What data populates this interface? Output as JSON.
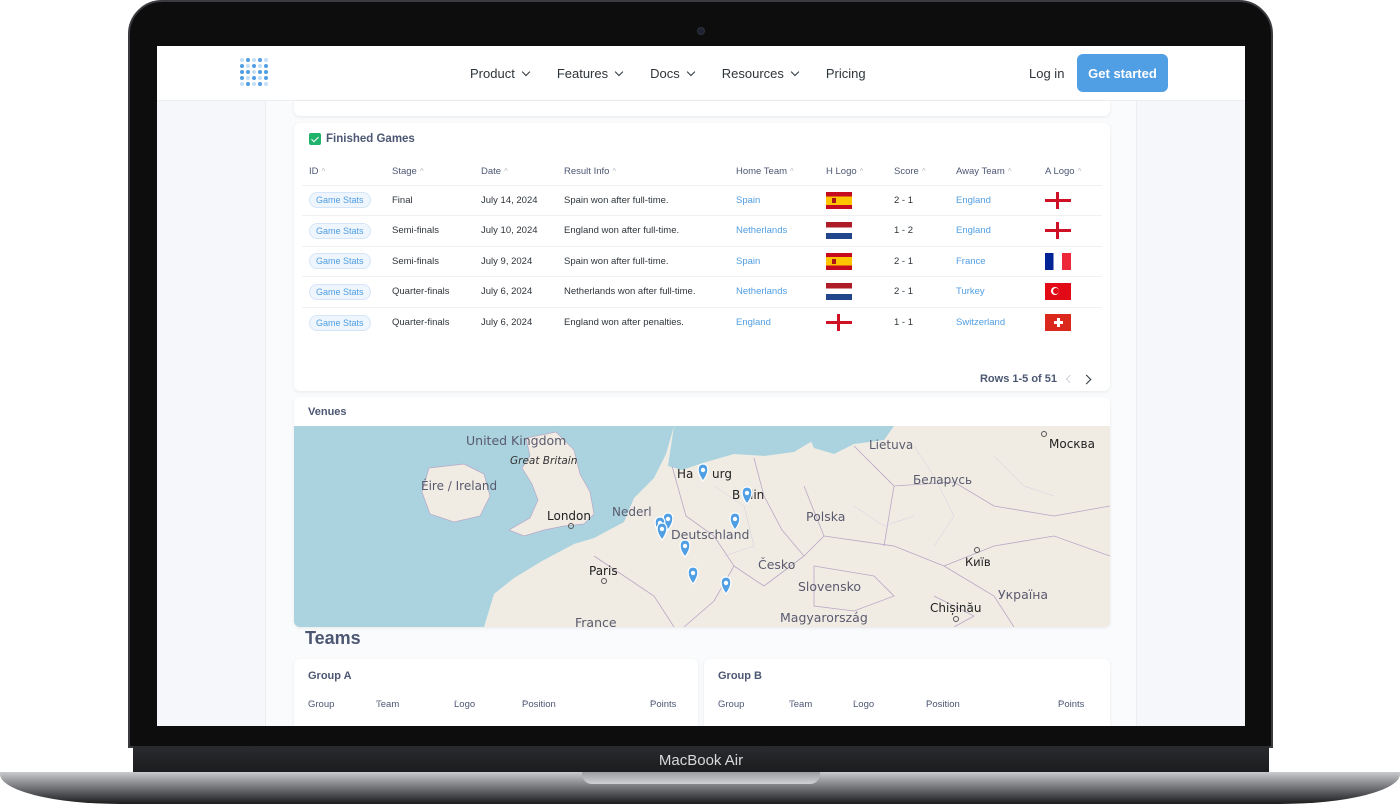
{
  "device_label": "MacBook Air",
  "nav": {
    "menu": [
      {
        "label": "Product",
        "has_dropdown": true
      },
      {
        "label": "Features",
        "has_dropdown": true
      },
      {
        "label": "Docs",
        "has_dropdown": true
      },
      {
        "label": "Resources",
        "has_dropdown": true
      },
      {
        "label": "Pricing",
        "has_dropdown": false
      }
    ],
    "login": "Log in",
    "cta": "Get started"
  },
  "finished_games": {
    "title": "Finished Games",
    "columns": [
      "ID",
      "Stage",
      "Date",
      "Result Info",
      "Home Team",
      "H Logo",
      "Score",
      "Away Team",
      "A Logo"
    ],
    "rows": [
      {
        "id": "Game Stats",
        "stage": "Final",
        "date": "July 14, 2024",
        "result": "Spain won after full-time.",
        "home": "Spain",
        "home_flag": "es",
        "score": "2 - 1",
        "away": "England",
        "away_flag": "en"
      },
      {
        "id": "Game Stats",
        "stage": "Semi-finals",
        "date": "July 10, 2024",
        "result": "England won after full-time.",
        "home": "Netherlands",
        "home_flag": "nl",
        "score": "1 - 2",
        "away": "England",
        "away_flag": "en"
      },
      {
        "id": "Game Stats",
        "stage": "Semi-finals",
        "date": "July 9, 2024",
        "result": "Spain won after full-time.",
        "home": "Spain",
        "home_flag": "es",
        "score": "2 - 1",
        "away": "France",
        "away_flag": "fr"
      },
      {
        "id": "Game Stats",
        "stage": "Quarter-finals",
        "date": "July 6, 2024",
        "result": "Netherlands won after full-time.",
        "home": "Netherlands",
        "home_flag": "nl",
        "score": "2 - 1",
        "away": "Turkey",
        "away_flag": "tr"
      },
      {
        "id": "Game Stats",
        "stage": "Quarter-finals",
        "date": "July 6, 2024",
        "result": "England won after penalties.",
        "home": "England",
        "home_flag": "en",
        "score": "1 - 1",
        "away": "Switzerland",
        "away_flag": "ch"
      }
    ],
    "pager": "Rows 1-5 of 51"
  },
  "venues": {
    "title": "Venues",
    "map_labels": {
      "uk": "United Kingdom",
      "gb": "Great Britain",
      "ireland": "Éire / Ireland",
      "london": "London",
      "neder": "Nederl",
      "ham1": "Ha",
      "ham2": "urg",
      "berlin1": "B",
      "berlin2": "lin",
      "deutschland": "Deutschland",
      "polska": "Polska",
      "lietuva": "Lietuva",
      "moskva": "Москва",
      "belarus": "Беларусь",
      "paris": "Paris",
      "cesko": "Česko",
      "slovensko": "Slovensko",
      "kyiv": "Київ",
      "ukraina": "Україна",
      "chisinau": "Chișinău",
      "magyar": "Magyarország",
      "france": "France"
    }
  },
  "teams": {
    "title": "Teams",
    "groups": [
      {
        "title": "Group A",
        "columns": [
          "Group",
          "Team",
          "Logo",
          "Position",
          "Points"
        ]
      },
      {
        "title": "Group B",
        "columns": [
          "Group",
          "Team",
          "Logo",
          "Position",
          "Points"
        ]
      }
    ]
  },
  "colors": {
    "accent": "#509ee3",
    "text": "#2e353b",
    "muted": "#4c5773",
    "success": "#21b36b"
  }
}
